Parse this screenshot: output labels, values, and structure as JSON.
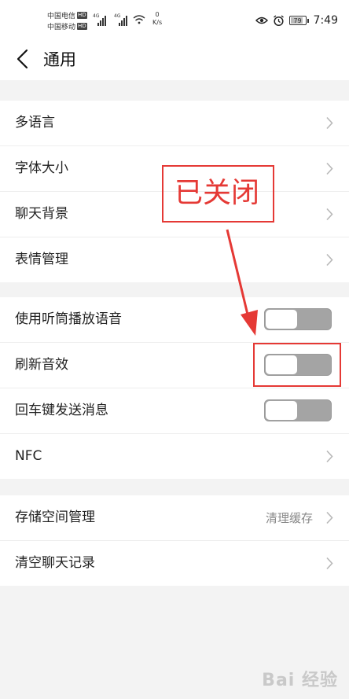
{
  "status_bar": {
    "carrier_1": "中国电信",
    "carrier_2": "中国移动",
    "hd": "HD",
    "net_type": "4G",
    "speed_value": "0",
    "speed_unit": "K/s",
    "battery": "79",
    "time": "7:49"
  },
  "header": {
    "title": "通用"
  },
  "group1": [
    {
      "label": "多语言"
    },
    {
      "label": "字体大小"
    },
    {
      "label": "聊天背景"
    },
    {
      "label": "表情管理"
    }
  ],
  "group2": [
    {
      "label": "使用听筒播放语音",
      "toggle": "off"
    },
    {
      "label": "刷新音效",
      "toggle": "off"
    },
    {
      "label": "回车键发送消息",
      "toggle": "off"
    },
    {
      "label": "NFC"
    }
  ],
  "group3": [
    {
      "label": "存储空间管理",
      "value": "清理缓存"
    },
    {
      "label": "清空聊天记录"
    }
  ],
  "annotation": {
    "text": "已关闭",
    "color": "#e53935"
  },
  "watermark": "Bai 经验",
  "colors": {
    "toggle_off": "#a4a4a4",
    "page_bg": "#f3f3f3"
  }
}
